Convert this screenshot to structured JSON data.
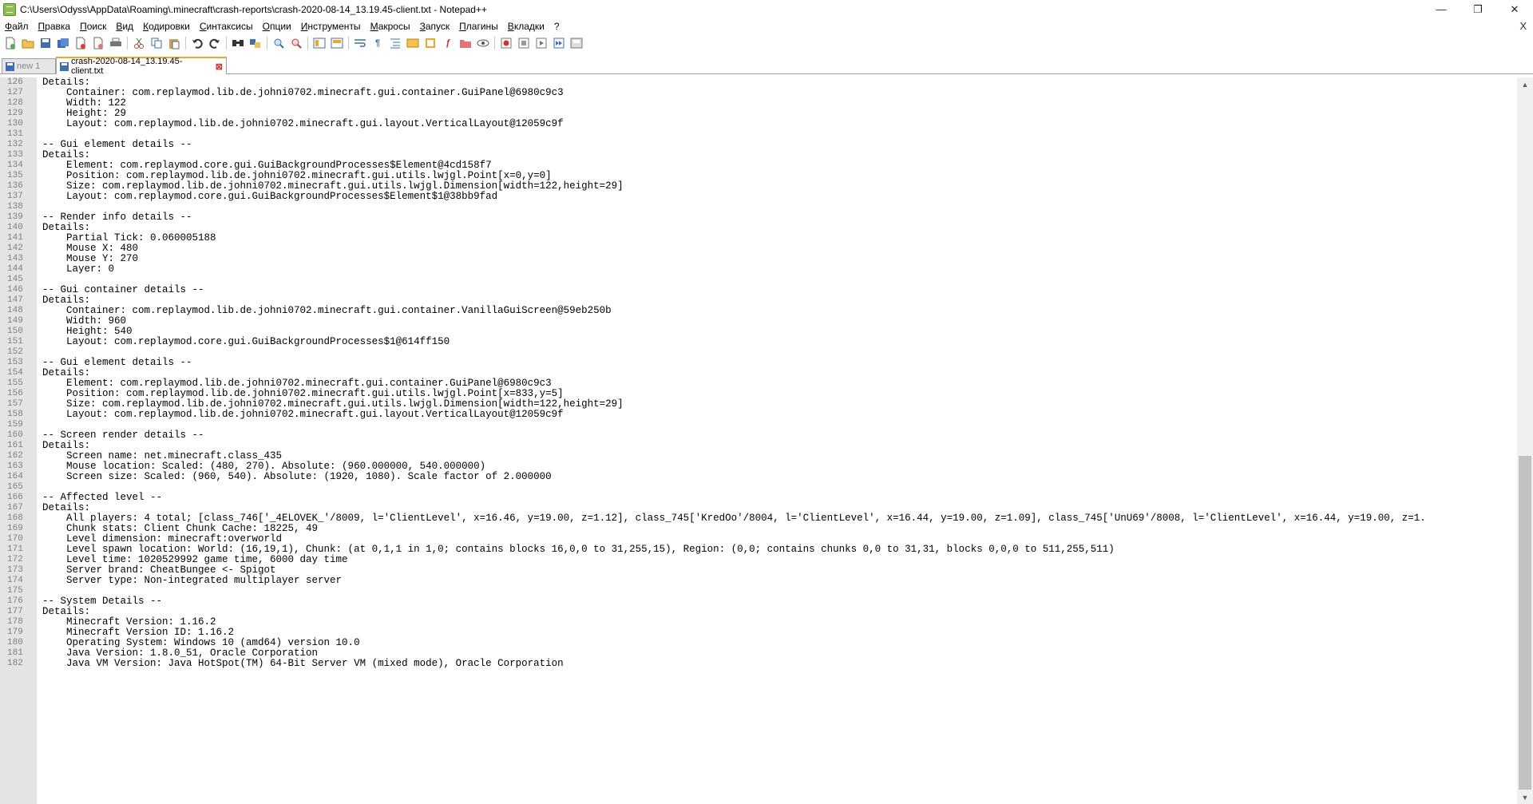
{
  "window": {
    "title": "C:\\Users\\Odyss\\AppData\\Roaming\\.minecraft\\crash-reports\\crash-2020-08-14_13.19.45-client.txt - Notepad++",
    "minimize": "—",
    "maximize": "❐",
    "close": "✕"
  },
  "menu": {
    "items": [
      "Файл",
      "Правка",
      "Поиск",
      "Вид",
      "Кодировки",
      "Синтаксисы",
      "Опции",
      "Инструменты",
      "Макросы",
      "Запуск",
      "Плагины",
      "Вкладки",
      "?"
    ],
    "close_x": "X"
  },
  "toolbar": {
    "icons": [
      "new-file-icon",
      "open-file-icon",
      "save-icon",
      "save-all-icon",
      "close-icon",
      "close-all-icon",
      "print-icon",
      "cut-icon",
      "copy-icon",
      "paste-icon",
      "undo-icon",
      "redo-icon",
      "find-icon",
      "replace-icon",
      "zoom-in-icon",
      "zoom-out-icon",
      "sync-vertical-icon",
      "sync-horizontal-icon",
      "word-wrap-icon",
      "show-all-chars-icon",
      "indent-guide-icon",
      "udl-icon",
      "doc-map-icon",
      "function-list-icon",
      "folder-workspace-icon",
      "monitoring-icon",
      "record-macro-icon",
      "stop-record-icon",
      "play-macro-icon",
      "run-macro-multiple-icon",
      "save-macro-icon"
    ]
  },
  "tabs": [
    {
      "label": "new 1",
      "active": false
    },
    {
      "label": "crash-2020-08-14_13.19.45-client.txt",
      "active": true,
      "close": "⊠"
    }
  ],
  "editor": {
    "lines": [
      {
        "n": "126",
        "t": "Details:"
      },
      {
        "n": "127",
        "t": "    Container: com.replaymod.lib.de.johni0702.minecraft.gui.container.GuiPanel@6980c9c3"
      },
      {
        "n": "128",
        "t": "    Width: 122"
      },
      {
        "n": "129",
        "t": "    Height: 29"
      },
      {
        "n": "130",
        "t": "    Layout: com.replaymod.lib.de.johni0702.minecraft.gui.layout.VerticalLayout@12059c9f"
      },
      {
        "n": "131",
        "t": ""
      },
      {
        "n": "132",
        "t": "-- Gui element details --"
      },
      {
        "n": "133",
        "t": "Details:"
      },
      {
        "n": "134",
        "t": "    Element: com.replaymod.core.gui.GuiBackgroundProcesses$Element@4cd158f7"
      },
      {
        "n": "135",
        "t": "    Position: com.replaymod.lib.de.johni0702.minecraft.gui.utils.lwjgl.Point[x=0,y=0]"
      },
      {
        "n": "136",
        "t": "    Size: com.replaymod.lib.de.johni0702.minecraft.gui.utils.lwjgl.Dimension[width=122,height=29]"
      },
      {
        "n": "137",
        "t": "    Layout: com.replaymod.core.gui.GuiBackgroundProcesses$Element$1@38bb9fad"
      },
      {
        "n": "138",
        "t": ""
      },
      {
        "n": "139",
        "t": "-- Render info details --"
      },
      {
        "n": "140",
        "t": "Details:"
      },
      {
        "n": "141",
        "t": "    Partial Tick: 0.060005188"
      },
      {
        "n": "142",
        "t": "    Mouse X: 480"
      },
      {
        "n": "143",
        "t": "    Mouse Y: 270"
      },
      {
        "n": "144",
        "t": "    Layer: 0"
      },
      {
        "n": "145",
        "t": ""
      },
      {
        "n": "146",
        "t": "-- Gui container details --"
      },
      {
        "n": "147",
        "t": "Details:"
      },
      {
        "n": "148",
        "t": "    Container: com.replaymod.lib.de.johni0702.minecraft.gui.container.VanillaGuiScreen@59eb250b"
      },
      {
        "n": "149",
        "t": "    Width: 960"
      },
      {
        "n": "150",
        "t": "    Height: 540"
      },
      {
        "n": "151",
        "t": "    Layout: com.replaymod.core.gui.GuiBackgroundProcesses$1@614ff150"
      },
      {
        "n": "152",
        "t": ""
      },
      {
        "n": "153",
        "t": "-- Gui element details --"
      },
      {
        "n": "154",
        "t": "Details:"
      },
      {
        "n": "155",
        "t": "    Element: com.replaymod.lib.de.johni0702.minecraft.gui.container.GuiPanel@6980c9c3"
      },
      {
        "n": "156",
        "t": "    Position: com.replaymod.lib.de.johni0702.minecraft.gui.utils.lwjgl.Point[x=833,y=5]"
      },
      {
        "n": "157",
        "t": "    Size: com.replaymod.lib.de.johni0702.minecraft.gui.utils.lwjgl.Dimension[width=122,height=29]"
      },
      {
        "n": "158",
        "t": "    Layout: com.replaymod.lib.de.johni0702.minecraft.gui.layout.VerticalLayout@12059c9f"
      },
      {
        "n": "159",
        "t": ""
      },
      {
        "n": "160",
        "t": "-- Screen render details --"
      },
      {
        "n": "161",
        "t": "Details:"
      },
      {
        "n": "162",
        "t": "    Screen name: net.minecraft.class_435"
      },
      {
        "n": "163",
        "t": "    Mouse location: Scaled: (480, 270). Absolute: (960.000000, 540.000000)"
      },
      {
        "n": "164",
        "t": "    Screen size: Scaled: (960, 540). Absolute: (1920, 1080). Scale factor of 2.000000"
      },
      {
        "n": "165",
        "t": ""
      },
      {
        "n": "166",
        "t": "-- Affected level --"
      },
      {
        "n": "167",
        "t": "Details:"
      },
      {
        "n": "168",
        "t": "    All players: 4 total; [class_746['_4ELOVEK_'/8009, l='ClientLevel', x=16.46, y=19.00, z=1.12], class_745['KredOo'/8004, l='ClientLevel', x=16.44, y=19.00, z=1.09], class_745['UnU69'/8008, l='ClientLevel', x=16.44, y=19.00, z=1."
      },
      {
        "n": "169",
        "t": "    Chunk stats: Client Chunk Cache: 18225, 49"
      },
      {
        "n": "170",
        "t": "    Level dimension: minecraft:overworld"
      },
      {
        "n": "171",
        "t": "    Level spawn location: World: (16,19,1), Chunk: (at 0,1,1 in 1,0; contains blocks 16,0,0 to 31,255,15), Region: (0,0; contains chunks 0,0 to 31,31, blocks 0,0,0 to 511,255,511)"
      },
      {
        "n": "172",
        "t": "    Level time: 1020529992 game time, 6000 day time"
      },
      {
        "n": "173",
        "t": "    Server brand: CheatBungee <- Spigot"
      },
      {
        "n": "174",
        "t": "    Server type: Non-integrated multiplayer server"
      },
      {
        "n": "175",
        "t": ""
      },
      {
        "n": "176",
        "t": "-- System Details --"
      },
      {
        "n": "177",
        "t": "Details:"
      },
      {
        "n": "178",
        "t": "    Minecraft Version: 1.16.2"
      },
      {
        "n": "179",
        "t": "    Minecraft Version ID: 1.16.2"
      },
      {
        "n": "180",
        "t": "    Operating System: Windows 10 (amd64) version 10.0"
      },
      {
        "n": "181",
        "t": "    Java Version: 1.8.0_51, Oracle Corporation"
      },
      {
        "n": "182",
        "t": "    Java VM Version: Java HotSpot(TM) 64-Bit Server VM (mixed mode), Oracle Corporation"
      }
    ]
  },
  "scrollbar": {
    "up": "▲",
    "down": "▼",
    "position": 0.52
  }
}
